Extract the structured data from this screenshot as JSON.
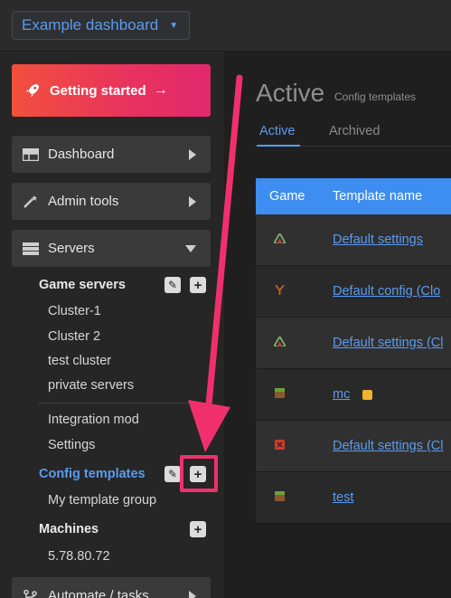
{
  "topbar": {
    "dashboard_select": "Example dashboard"
  },
  "sidebar": {
    "getting_started": "Getting started",
    "nav": [
      {
        "label": "Dashboard",
        "icon": "dashboard-icon"
      },
      {
        "label": "Admin tools",
        "icon": "magic-wand-icon"
      },
      {
        "label": "Servers",
        "icon": "server-icon"
      }
    ],
    "game_servers": {
      "heading": "Game servers",
      "items": [
        "Cluster-1",
        "Cluster 2",
        "test cluster",
        "private servers"
      ]
    },
    "extra_items": [
      "Integration mod",
      "Settings"
    ],
    "config_templates": {
      "heading": "Config templates",
      "items": [
        "My template group"
      ]
    },
    "machines": {
      "heading": "Machines",
      "items": [
        "5.78.80.72"
      ]
    },
    "automate": "Automate / tasks"
  },
  "main": {
    "title": "Active",
    "subtitle": "Config templates",
    "tabs": [
      "Active",
      "Archived"
    ],
    "table": {
      "headers": [
        "Game",
        "Template name"
      ],
      "rows": [
        {
          "game_icon": "ark-icon",
          "name": "Default settings"
        },
        {
          "game_icon": "rust-icon",
          "name": "Default config (Clo"
        },
        {
          "game_icon": "ark-icon",
          "name": "Default settings (Cl"
        },
        {
          "game_icon": "minecraft-icon",
          "name": "mc"
        },
        {
          "game_icon": "red-game-icon",
          "name": "Default settings (Cl"
        },
        {
          "game_icon": "minecraft-icon",
          "name": "test"
        }
      ]
    }
  },
  "colors": {
    "accent": "#5a9bf0",
    "highlight": "#f0306e",
    "header_blue": "#3e8df0"
  }
}
